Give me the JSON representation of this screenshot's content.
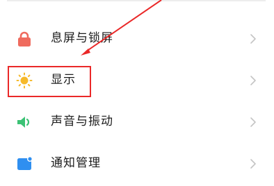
{
  "settings": {
    "items": [
      {
        "icon": "lock-icon",
        "label": "息屏与锁屏",
        "chevron": "chevron-right-icon"
      },
      {
        "icon": "sun-icon",
        "label": "显示",
        "chevron": "chevron-right-icon"
      },
      {
        "icon": "speaker-icon",
        "label": "声音与振动",
        "chevron": "chevron-right-icon"
      },
      {
        "icon": "notification-icon",
        "label": "通知管理",
        "chevron": "chevron-right-icon"
      }
    ]
  },
  "colors": {
    "lock": "#ef6b5e",
    "sun": "#f6b92b",
    "speaker": "#3cc275",
    "notification": "#2f8ff0",
    "annotation": "#ea2828",
    "chevron": "#c4c4c4",
    "text": "#1c1c1c"
  }
}
